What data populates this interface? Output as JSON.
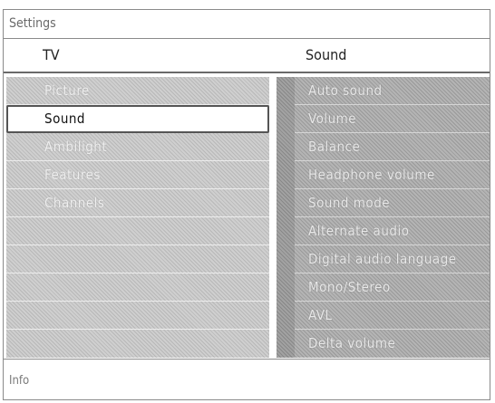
{
  "window": {
    "title": "Settings"
  },
  "header": {
    "left": "TV",
    "right": "Sound"
  },
  "left_menu": {
    "items": [
      {
        "label": "Picture",
        "selected": false
      },
      {
        "label": "Sound",
        "selected": true
      },
      {
        "label": "Ambilight",
        "selected": false
      },
      {
        "label": "Features",
        "selected": false
      },
      {
        "label": "Channels",
        "selected": false
      },
      {
        "label": "",
        "selected": false
      },
      {
        "label": "",
        "selected": false
      },
      {
        "label": "",
        "selected": false
      },
      {
        "label": "",
        "selected": false
      },
      {
        "label": "",
        "selected": false
      }
    ]
  },
  "right_menu": {
    "items": [
      {
        "label": "Auto sound"
      },
      {
        "label": "Volume"
      },
      {
        "label": "Balance"
      },
      {
        "label": "Headphone volume"
      },
      {
        "label": "Sound mode"
      },
      {
        "label": "Alternate audio"
      },
      {
        "label": "Digital audio language"
      },
      {
        "label": "Mono/Stereo"
      },
      {
        "label": "AVL"
      },
      {
        "label": "Delta volume"
      }
    ]
  },
  "footer": {
    "label": "Info"
  }
}
